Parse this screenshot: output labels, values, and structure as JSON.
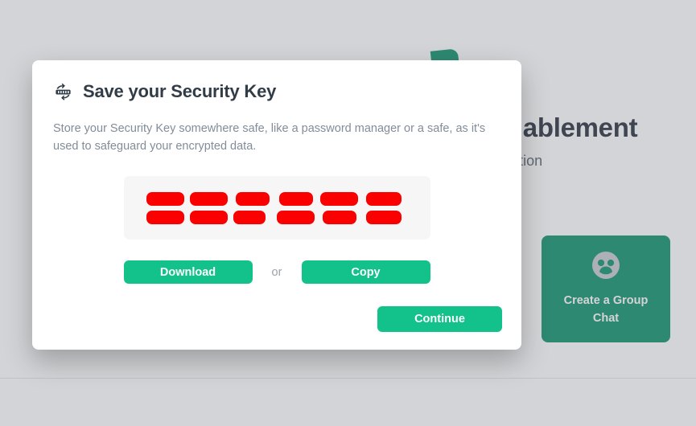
{
  "background": {
    "logo_icon": "app-logo-leaf-icon",
    "heading": "Encryption Enablement",
    "subheading": "Secure your conversation",
    "cards": [
      {
        "icon": "group-people-icon",
        "label": "Create a Group Chat"
      }
    ]
  },
  "modal": {
    "title": "Save your Security Key",
    "title_icon": "key-rotate-icon",
    "description": "Store your Security Key somewhere safe, like a password manager or a safe, as it's used to safeguard your encrypted data.",
    "security_key": {
      "state": "redacted",
      "redaction_color": "#fb0000",
      "rows": 2,
      "columns": 6,
      "blocks": [
        {
          "width": "w1"
        },
        {
          "width": "w1"
        },
        {
          "width": "w2"
        },
        {
          "width": "w2"
        },
        {
          "width": "w1"
        },
        {
          "width": "w4"
        },
        {
          "width": "w1"
        },
        {
          "width": "w1"
        },
        {
          "width": "w3"
        },
        {
          "width": "w1"
        },
        {
          "width": "w2"
        },
        {
          "width": "w4"
        }
      ]
    },
    "download_label": "Download",
    "or_label": "or",
    "copy_label": "Copy",
    "continue_label": "Continue"
  },
  "colors": {
    "accent_green": "#12c28a",
    "card_green": "#12946e",
    "redaction_red": "#fb0000",
    "overlay": "rgba(108,114,122,0.30)",
    "title_text": "#313c47",
    "body_text": "#828d99"
  }
}
